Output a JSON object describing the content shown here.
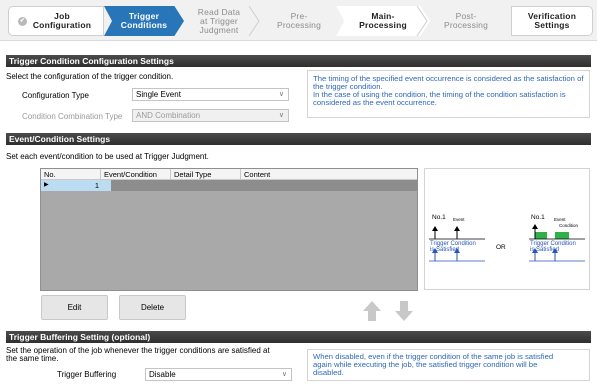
{
  "wizard": {
    "steps": [
      {
        "label": "Job\nConfiguration",
        "state": "done"
      },
      {
        "label": "Trigger\nConditions",
        "state": "active"
      },
      {
        "label": "Read Data\nat Trigger\nJudgment",
        "state": "disabled"
      },
      {
        "label": "Pre-\nProcessing",
        "state": "disabled"
      },
      {
        "label": "Main-\nProcessing",
        "state": "enabled"
      },
      {
        "label": "Post-\nProcessing",
        "state": "disabled"
      },
      {
        "label": "Verification\nSettings",
        "state": "enabled"
      }
    ]
  },
  "trigger_config": {
    "title": "Trigger Condition Configuration Settings",
    "instruction": "Select the configuration of the trigger condition.",
    "configuration_type_label": "Configuration Type",
    "configuration_type_value": "Single Event",
    "combination_type_label": "Condition Combination Type",
    "combination_type_value": "AND Combination",
    "note": "The timing of the specified event occurrence is considered as the satisfaction of the trigger condition.\nIn the case of using the condition, the timing of the condition satisfaction is considered as the event occurrence."
  },
  "event_settings": {
    "title": "Event/Condition Settings",
    "instruction": "Set each event/condition to be used at Trigger Judgment.",
    "columns": [
      "No.",
      "Event/Condition Type",
      "Detail Type",
      "Content"
    ],
    "rows": [
      {
        "no": "1",
        "event_type": "",
        "detail_type": "",
        "content": ""
      }
    ],
    "edit_label": "Edit",
    "delete_label": "Delete"
  },
  "diagram": {
    "left_no": "No.1",
    "left_event": "Event",
    "left_result": "Trigger Condition\nis Satisfied",
    "or_label": "OR",
    "right_no": "No.1",
    "right_event": "Event",
    "right_condition": "Condition",
    "right_result": "Trigger Condition\nis Satisfied"
  },
  "buffering": {
    "title": "Trigger Buffering Setting (optional)",
    "instruction": "Set the operation of the job whenever the trigger conditions are satisfied at\nthe same time.",
    "label": "Trigger Buffering",
    "value": "Disable",
    "note": "When disabled, even if the trigger condition of the same job is satisfied\nagain while executing the job, the satisfied trigger condition will be\ndisabled."
  },
  "colors": {
    "accent": "#2876b7",
    "note_text": "#2f68b5",
    "header_bg": "#3a3a3a",
    "selected_row": "#bcdcf2",
    "diagram_blue": "#2a55b5",
    "diagram_green": "#31b04a"
  }
}
